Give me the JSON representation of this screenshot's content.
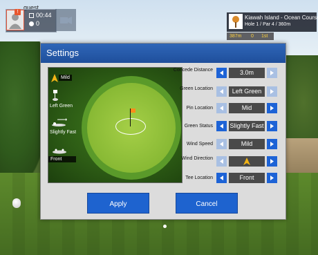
{
  "player": {
    "name": "guest",
    "time": "00:44",
    "shots": "0",
    "badge": "!"
  },
  "course": {
    "name": "Kiawah Island - Ocean Course",
    "hole_info": "Hole 1 / Par 4 / 360m",
    "stats": [
      "387m",
      "0",
      "1st"
    ]
  },
  "dialog": {
    "title": "Settings",
    "apply_label": "Apply",
    "cancel_label": "Cancel"
  },
  "green_view": {
    "wind_label": "Mild",
    "pin_label": "Left Green",
    "speed_label": "Slightly Fast",
    "tee_label": "Front"
  },
  "settings": [
    {
      "label": "Concede Distance",
      "value": "3.0m",
      "left_enabled": true,
      "right_enabled": false
    },
    {
      "label": "Green Location",
      "value": "Left Green",
      "left_enabled": false,
      "right_enabled": false
    },
    {
      "label": "Pin Location",
      "value": "Mid",
      "left_enabled": false,
      "right_enabled": true
    },
    {
      "label": "Green Status",
      "value": "Slightly Fast",
      "left_enabled": true,
      "right_enabled": true
    },
    {
      "label": "Wind Speed",
      "value": "Mild",
      "left_enabled": false,
      "right_enabled": true
    },
    {
      "label": "Wind Direction",
      "value": "",
      "left_enabled": false,
      "right_enabled": true
    },
    {
      "label": "Tee Location",
      "value": "Front",
      "left_enabled": true,
      "right_enabled": true
    }
  ],
  "colors": {
    "accent": "#1d63d6",
    "disabled": "#a9c0e3",
    "header": "#2f66b8",
    "flag": "#ff8c1a",
    "wind_arrow": "#f2b416"
  },
  "icons": [
    "person-icon",
    "timer-icon",
    "ball-icon",
    "camera-icon",
    "course-logo-icon",
    "wind-arrow-icon",
    "pin-icon",
    "green-speed-icon",
    "tee-icon"
  ]
}
